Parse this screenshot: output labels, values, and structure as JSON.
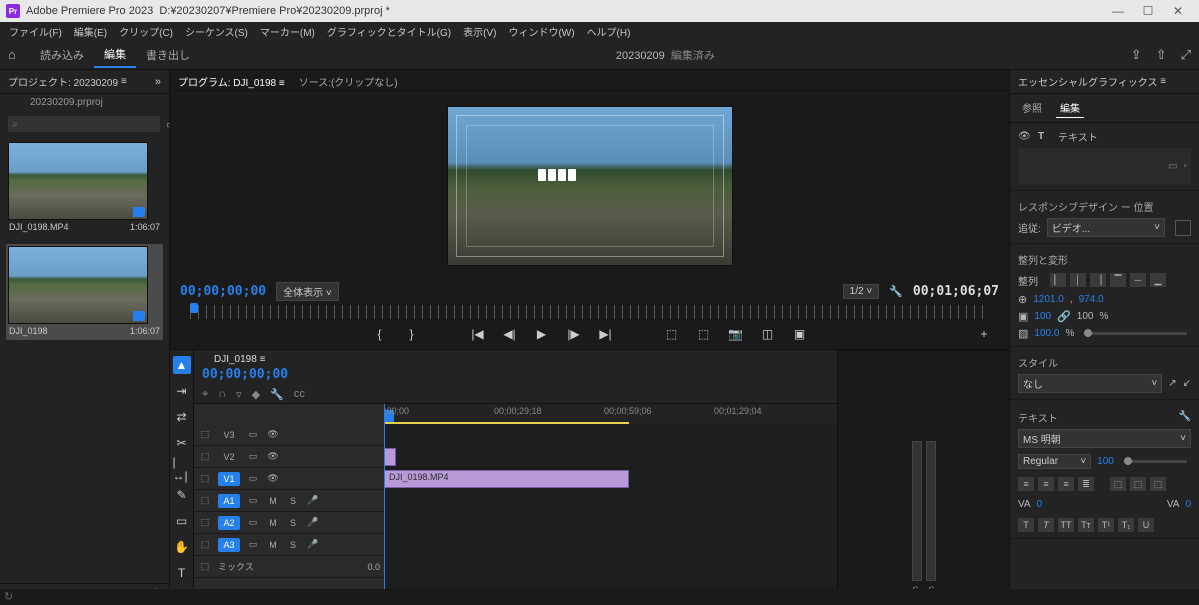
{
  "app": {
    "name": "Adobe Premiere Pro 2023",
    "doc_path": "D:¥20230207¥Premiere Pro¥20230209.prproj *",
    "icon_text": "Pr"
  },
  "menu": [
    "ファイル(F)",
    "編集(E)",
    "クリップ(C)",
    "シーケンス(S)",
    "マーカー(M)",
    "グラフィックとタイトル(G)",
    "表示(V)",
    "ウィンドウ(W)",
    "ヘルプ(H)"
  ],
  "workspace": {
    "tabs": [
      "読み込み",
      "編集",
      "書き出し"
    ],
    "active": 1,
    "project_title": "20230209",
    "edited": "編集済み"
  },
  "project_panel": {
    "title": "プロジェクト: 20230209",
    "breadcrumb": "20230209.prproj",
    "search_placeholder": "⌕",
    "bins": [
      {
        "name": "DJI_0198.MP4",
        "dur": "1:06:07",
        "selected": false
      },
      {
        "name": "DJI_0198",
        "dur": "1:06:07",
        "selected": true
      }
    ]
  },
  "program": {
    "tab1": "プログラム: DJI_0198",
    "tab2": "ソース:(クリップなし)",
    "timecode_in": "00;00;00;00",
    "display": "全体表示",
    "zoom": "1/2",
    "timecode_out": "00;01;06;07"
  },
  "timeline": {
    "seq_name": "DJI_0198",
    "timecode": "00;00;00;00",
    "ticks": [
      {
        "label": ";00;00",
        "pos": 0
      },
      {
        "label": "00;00;29;18",
        "pos": 110
      },
      {
        "label": "00;00;59;06",
        "pos": 220
      },
      {
        "label": "00;01;29;04",
        "pos": 330
      }
    ],
    "v_tracks": [
      {
        "name": "V3",
        "on": false
      },
      {
        "name": "V2",
        "on": false
      },
      {
        "name": "V1",
        "on": true
      }
    ],
    "a_tracks": [
      {
        "name": "A1",
        "on": true
      },
      {
        "name": "A2",
        "on": true
      },
      {
        "name": "A3",
        "on": true
      }
    ],
    "clip_label": "DJI_0198.MP4",
    "mix_label": "ミックス",
    "mix_val": "0.0",
    "meters": {
      "s1": "S",
      "s2": "S"
    }
  },
  "eg": {
    "title": "エッセンシャルグラフィックス",
    "tabs": [
      "参照",
      "編集"
    ],
    "layer_type": "テキスト",
    "respon": "レスポンシブデザイン ー 位置",
    "follow_lbl": "追従:",
    "follow_val": "ビデオ...",
    "align_title": "整列と変形",
    "align_lbl": "整列",
    "pos_x": "1201.0",
    "pos_y": "974.0",
    "scale": "100",
    "scale2": "100",
    "opacity": "100.0",
    "pct": "%",
    "style_title": "スタイル",
    "style_val": "なし",
    "text_title": "テキスト",
    "font": "MS 明朝",
    "weight": "Regular",
    "size": "100",
    "kerning_label": "VA",
    "kerning": "0"
  }
}
